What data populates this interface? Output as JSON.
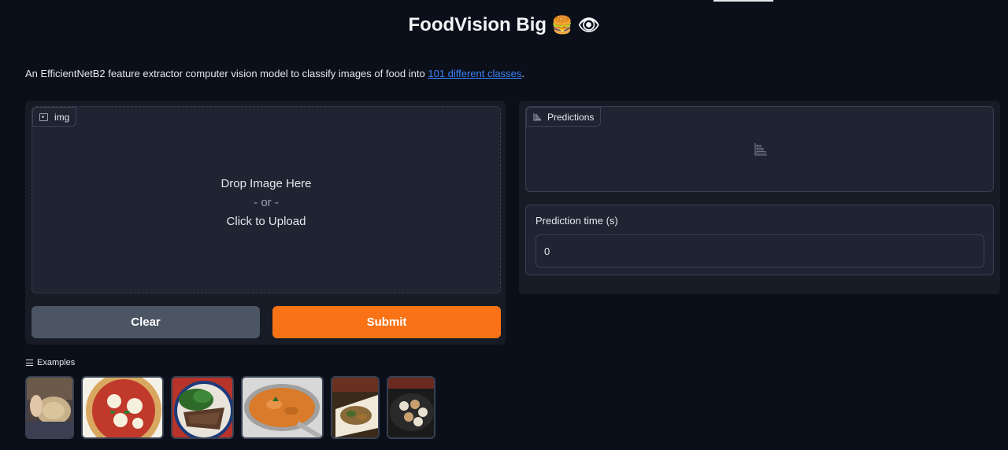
{
  "header": {
    "title": "FoodVision Big",
    "emojis": "🍔 👁"
  },
  "description": {
    "text_before": "An EfficientNetB2 feature extractor computer vision model to classify images of food into ",
    "link_text": "101 different classes",
    "text_after": "."
  },
  "image_input": {
    "label": "img",
    "drop_text": "Drop Image Here",
    "or_text": "- or -",
    "upload_text": "Click to Upload"
  },
  "buttons": {
    "clear_label": "Clear",
    "submit_label": "Submit"
  },
  "predictions": {
    "label": "Predictions"
  },
  "prediction_time": {
    "label": "Prediction time (s)",
    "value": "0"
  },
  "examples": {
    "label": "Examples",
    "items": [
      {
        "name": "example-image-1",
        "colors": [
          "#6b5a4a",
          "#c7b08a",
          "#3a3f52"
        ]
      },
      {
        "name": "example-image-pizza",
        "colors": [
          "#e8c98a",
          "#c0392b",
          "#f4f1e8"
        ]
      },
      {
        "name": "example-image-steak",
        "colors": [
          "#2e6b2a",
          "#5a3a28",
          "#b8332a"
        ]
      },
      {
        "name": "example-image-curry",
        "colors": [
          "#e8e8e8",
          "#d97b2a",
          "#a0a0a0"
        ]
      },
      {
        "name": "example-image-salad",
        "colors": [
          "#3a2a1a",
          "#8a6a3a",
          "#f0e8d8"
        ]
      },
      {
        "name": "example-image-sushi",
        "colors": [
          "#1a1a1a",
          "#c8a070",
          "#e8e0d0"
        ]
      }
    ]
  },
  "colors": {
    "background": "#0b0f19",
    "panel": "#161b26",
    "submit": "#f97316",
    "clear": "#4b5563",
    "link": "#3b82f6"
  }
}
